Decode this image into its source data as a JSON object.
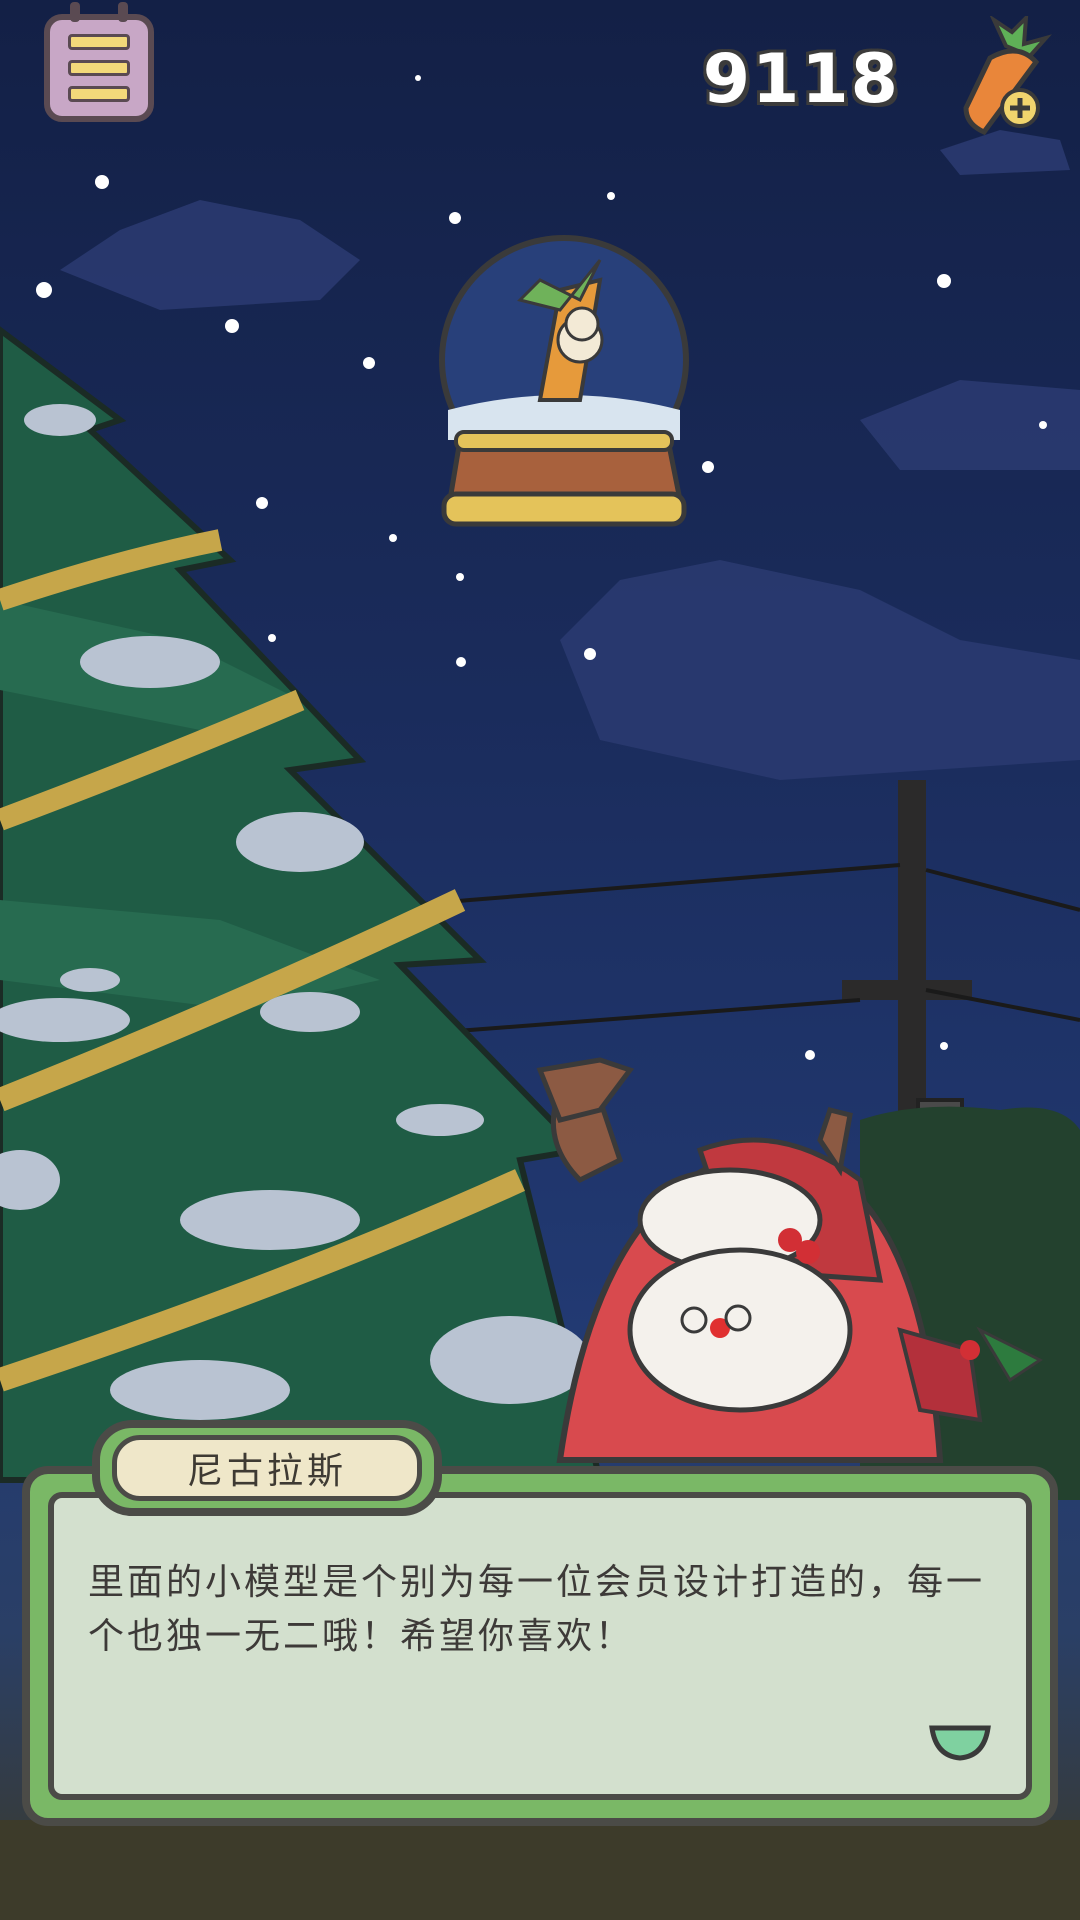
{
  "hud": {
    "carrot_count": "9118"
  },
  "speaker": {
    "name": "尼古拉斯"
  },
  "dialog": {
    "text": "里面的小模型是个别为每一位会员设计打造的，每一个也独一无二哦！希望你喜欢！"
  },
  "colors": {
    "sky_top": "#132046",
    "panel_green": "#7ab866",
    "outline": "#4b4b47"
  }
}
